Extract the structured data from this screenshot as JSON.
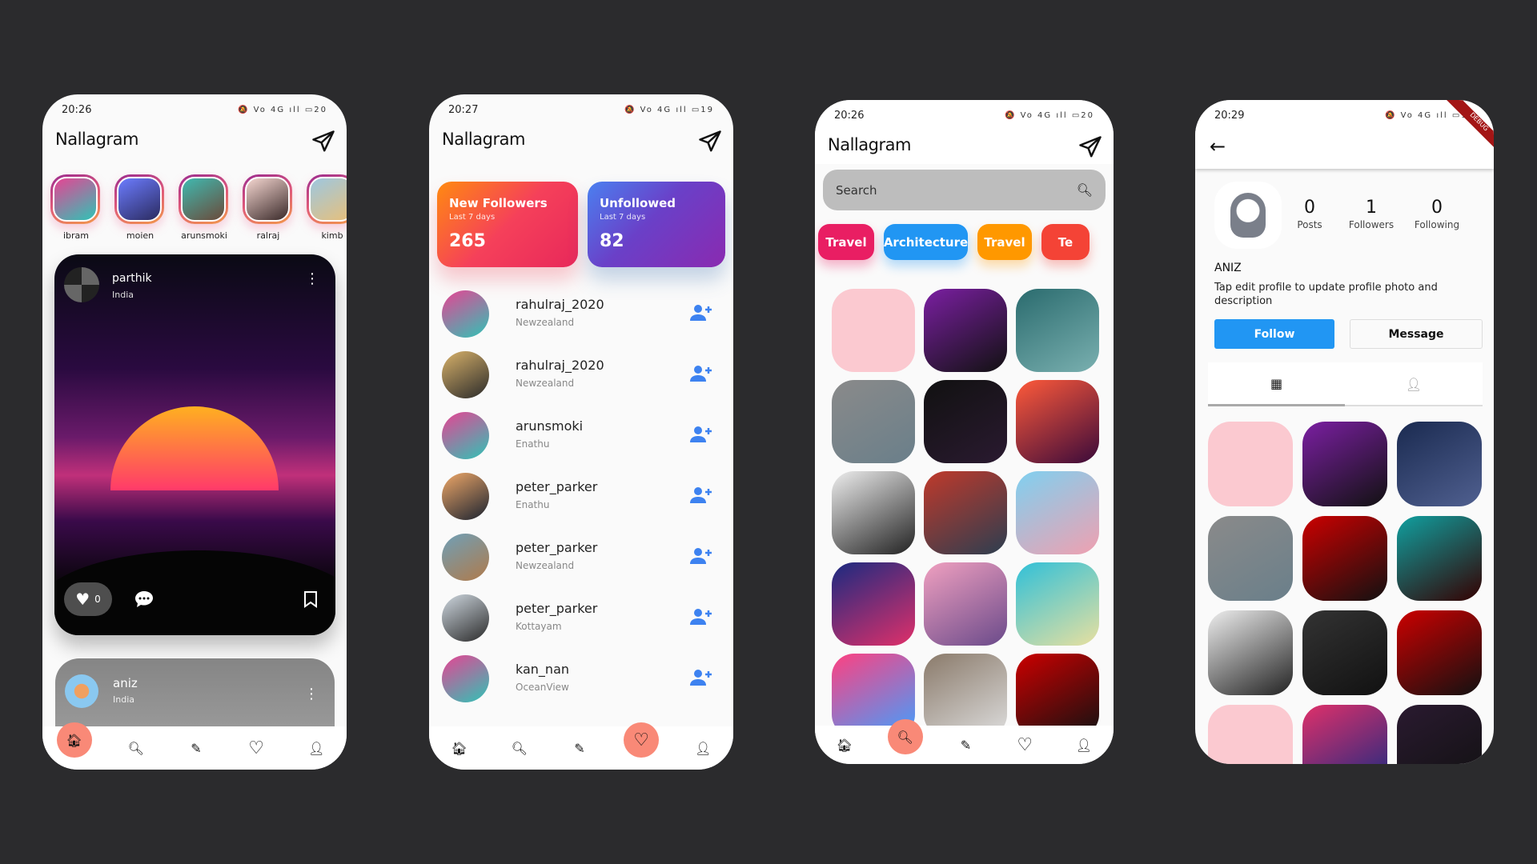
{
  "app_title": "Nallagram",
  "feed": {
    "time": "20:26",
    "status_icons": "🔕 Vo 4G ıll ▭20",
    "stories": [
      {
        "name": "ibram",
        "c": [
          "#e84393",
          "#2ec4b6"
        ]
      },
      {
        "name": "moien",
        "c": [
          "#6c7cff",
          "#2b2b60"
        ]
      },
      {
        "name": "arunsmoki",
        "c": [
          "#3fb9b0",
          "#6b4a3a"
        ]
      },
      {
        "name": "ralraj",
        "c": [
          "#f5d6d0",
          "#3a2a2a"
        ]
      },
      {
        "name": "kimb",
        "c": [
          "#9dc7e0",
          "#e8c07a"
        ]
      }
    ],
    "post": {
      "user": "parthik",
      "location": "India",
      "likes": "0"
    },
    "post2": {
      "user": "aniz",
      "location": "India"
    }
  },
  "activity": {
    "time": "20:27",
    "status_icons": "🔕 Vo 4G ıll ▭19",
    "new_followers": {
      "title": "New Followers",
      "subtitle": "Last 7 days",
      "count": "265"
    },
    "unfollowed": {
      "title": "Unfollowed",
      "subtitle": "Last 7 days",
      "count": "82"
    },
    "users": [
      {
        "name": "rahulraj_2020",
        "location": "Newzealand",
        "c": [
          "#e84393",
          "#2ec4b6"
        ]
      },
      {
        "name": "rahulraj_2020",
        "location": "Newzealand",
        "c": [
          "#d9b26a",
          "#2a2a2a"
        ]
      },
      {
        "name": "arunsmoki",
        "location": "Enathu",
        "c": [
          "#e84393",
          "#2ec4b6"
        ]
      },
      {
        "name": "peter_parker",
        "location": "Enathu",
        "c": [
          "#f0a868",
          "#1a2230"
        ]
      },
      {
        "name": "peter_parker",
        "location": "Newzealand",
        "c": [
          "#6fa0b8",
          "#b07a4a"
        ]
      },
      {
        "name": "peter_parker",
        "location": "Kottayam",
        "c": [
          "#cfd8e0",
          "#2a2a2a"
        ]
      },
      {
        "name": "kan_nan",
        "location": "OceanView",
        "c": [
          "#e84393",
          "#2ec4b6"
        ]
      }
    ]
  },
  "explore": {
    "time": "20:26",
    "status_icons": "🔕 Vo 4G ıll ▭20",
    "search_placeholder": "Search",
    "chips": [
      {
        "label": "Travel",
        "color": "#e91e63"
      },
      {
        "label": "Architecture",
        "color": "#2196f3"
      },
      {
        "label": "Travel",
        "color": "#ff9800"
      },
      {
        "label": "Te",
        "color": "#f44336"
      }
    ],
    "tiles": [
      [
        "#fbc9d0",
        "#fbc9d0"
      ],
      [
        "#7b1fa2",
        "#111"
      ],
      [
        "#2a6b6e",
        "#7ab0b0"
      ],
      [
        "#8a8a8a",
        "#6a7f8a"
      ],
      [
        "#111",
        "#2a1a30"
      ],
      [
        "#ff5a3a",
        "#3a0a3a"
      ],
      [
        "#eee",
        "#222"
      ],
      [
        "#c0392b",
        "#2c3e50"
      ],
      [
        "#7fd0f0",
        "#f0a0b0"
      ],
      [
        "#1a2a80",
        "#e0306a"
      ],
      [
        "#f0a0c0",
        "#6a4a8a"
      ],
      [
        "#30c0d8",
        "#e8e0a0"
      ],
      [
        "#ff4080",
        "#40a0ff"
      ],
      [
        "#8a7a6a",
        "#ddd"
      ],
      [
        "#c00",
        "#111"
      ]
    ]
  },
  "profile": {
    "time": "20:29",
    "status_icons": "🔕 Vo 4G ıll ▭18",
    "debug_banner": "DEBUG",
    "name": "ANIZ",
    "description": "Tap edit profile to update profile photo and description",
    "stats": [
      {
        "value": "0",
        "label": "Posts"
      },
      {
        "value": "1",
        "label": "Followers"
      },
      {
        "value": "0",
        "label": "Following"
      }
    ],
    "follow_label": "Follow",
    "message_label": "Message",
    "follow_color": "#2196f3",
    "tiles": [
      [
        "#fbc9d0",
        "#fbc9d0"
      ],
      [
        "#7b1fa2",
        "#111"
      ],
      [
        "#1a2a50",
        "#506090"
      ],
      [
        "#8a8a8a",
        "#6a7f8a"
      ],
      [
        "#c00",
        "#111"
      ],
      [
        "#10a0a0",
        "#300"
      ],
      [
        "#eee",
        "#222"
      ],
      [
        "#333",
        "#111"
      ],
      [
        "#c00",
        "#111"
      ],
      [
        "#fbc9d0",
        "#fbc9d0"
      ],
      [
        "#e0306a",
        "#1a2a80"
      ],
      [
        "#2a1a30",
        "#111"
      ]
    ]
  }
}
